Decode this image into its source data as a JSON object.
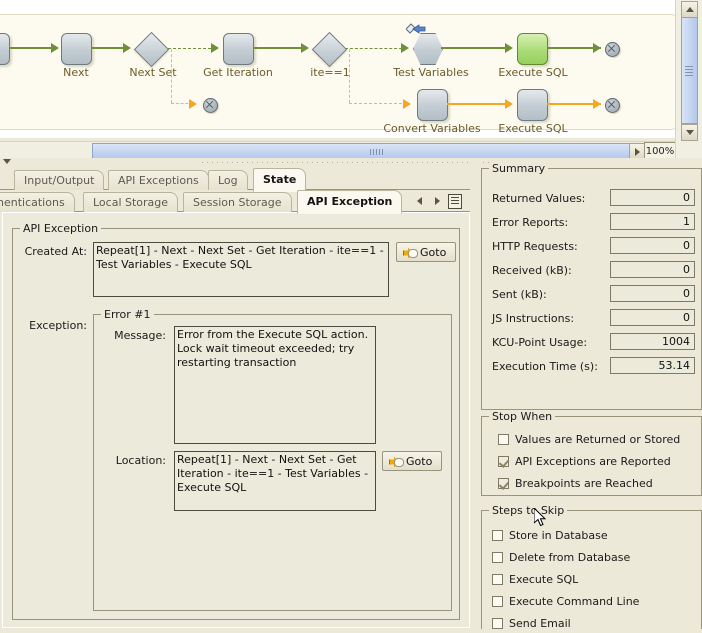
{
  "diagram": {
    "zoom_level": "100%",
    "nodes": [
      {
        "label": "",
        "type": "box",
        "state": "normal"
      },
      {
        "label": "Next",
        "type": "box",
        "state": "normal"
      },
      {
        "label": "Next Set",
        "type": "diamond",
        "state": "normal"
      },
      {
        "label": "Get Iteration",
        "type": "box",
        "state": "normal"
      },
      {
        "label": "ite==1",
        "type": "diamond",
        "state": "normal"
      },
      {
        "label": "Test Variables",
        "type": "hexagon",
        "state": "breakpoint"
      },
      {
        "label": "Execute SQL",
        "type": "box",
        "state": "active"
      },
      {
        "label": "Convert Variables",
        "type": "box",
        "state": "normal"
      },
      {
        "label": "Execute SQL",
        "type": "box",
        "state": "normal"
      }
    ]
  },
  "tabs_primary": {
    "items": [
      {
        "label": "Input/Output",
        "active": false
      },
      {
        "label": "API Exceptions",
        "active": false
      },
      {
        "label": "Log",
        "active": false
      },
      {
        "label": "State",
        "active": true
      }
    ]
  },
  "tabs_secondary": {
    "items": [
      {
        "label": "hentications",
        "active": false
      },
      {
        "label": "Local Storage",
        "active": false
      },
      {
        "label": "Session Storage",
        "active": false
      },
      {
        "label": "API Exception",
        "active": true
      }
    ]
  },
  "api_exception": {
    "group_title": "API Exception",
    "created_at_label": "Created At:",
    "created_at_value": "Repeat[1] - Next - Next Set - Get Iteration - ite==1 - Test Variables - Execute SQL",
    "goto_label": "Goto",
    "exception_label": "Exception:",
    "error_group_title": "Error #1",
    "message_label": "Message:",
    "message_value": "Error from the Execute SQL action. Lock wait timeout exceeded; try restarting transaction",
    "location_label": "Location:",
    "location_value": "Repeat[1] - Next - Next Set - Get Iteration - ite==1 - Test Variables - Execute SQL",
    "location_goto_label": "Goto"
  },
  "summary": {
    "title": "Summary",
    "rows": [
      {
        "label": "Returned Values:",
        "value": "0"
      },
      {
        "label": "Error Reports:",
        "value": "1"
      },
      {
        "label": "HTTP Requests:",
        "value": "0"
      },
      {
        "label": "Received (kB):",
        "value": "0"
      },
      {
        "label": "Sent (kB):",
        "value": "0"
      },
      {
        "label": "JS Instructions:",
        "value": "0"
      },
      {
        "label": "KCU-Point Usage:",
        "value": "1004"
      },
      {
        "label": "Execution Time (s):",
        "value": "53.14"
      }
    ]
  },
  "stop_when": {
    "title": "Stop When",
    "items": [
      {
        "label": "Values are Returned or Stored",
        "checked": false
      },
      {
        "label": "API Exceptions are Reported",
        "checked": true
      },
      {
        "label": "Breakpoints are Reached",
        "checked": true
      }
    ]
  },
  "steps_to_skip": {
    "title": "Steps to Skip",
    "items": [
      {
        "label": "Store in Database",
        "checked": false
      },
      {
        "label": "Delete from Database",
        "checked": false
      },
      {
        "label": "Execute SQL",
        "checked": false
      },
      {
        "label": "Execute Command Line",
        "checked": false
      },
      {
        "label": "Send Email",
        "checked": false
      }
    ]
  },
  "colors": {
    "panel_bg": "#ece9d8",
    "content_bg": "#eceadb",
    "flow_green": "#6f8f38",
    "flow_orange": "#f5a623",
    "active_node": "#a8da74",
    "label_text": "#6b5a2a"
  }
}
